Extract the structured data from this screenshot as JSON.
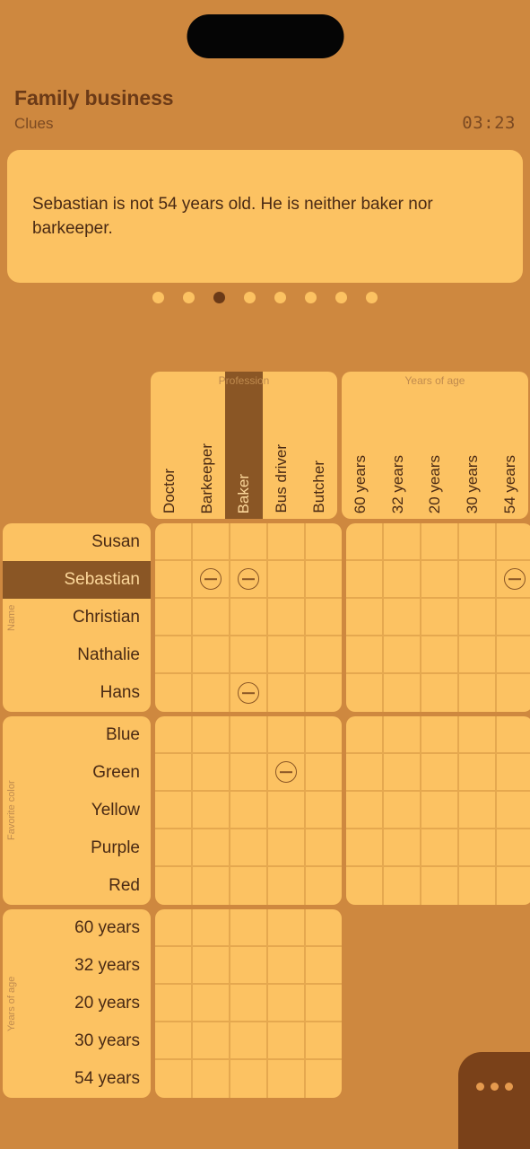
{
  "header": {
    "title": "Family business",
    "subtitle": "Clues",
    "timer": "03:23"
  },
  "clue": {
    "text": "Sebastian is not 54 years old. He is neither baker nor barkeeper."
  },
  "pager": {
    "total": 8,
    "active_index": 2
  },
  "colgroups": [
    {
      "title": "Profession",
      "columns": [
        "Doctor",
        "Barkeeper",
        "Baker",
        "Bus driver",
        "Butcher"
      ],
      "highlighted_column": 2
    },
    {
      "title": "Years of age",
      "columns": [
        "60 years",
        "32 years",
        "20 years",
        "30 years",
        "54 years"
      ],
      "highlighted_column": -1
    }
  ],
  "rowgroups": [
    {
      "title": "Name",
      "rows": [
        "Susan",
        "Sebastian",
        "Christian",
        "Nathalie",
        "Hans"
      ],
      "highlighted_row": 1,
      "blocks": [
        {
          "marks": [
            [
              "",
              "",
              "",
              "",
              ""
            ],
            [
              "",
              "minus",
              "minus",
              "",
              ""
            ],
            [
              "",
              "",
              "",
              "",
              ""
            ],
            [
              "",
              "",
              "",
              "",
              ""
            ],
            [
              "",
              "",
              "minus",
              "",
              ""
            ]
          ]
        },
        {
          "marks": [
            [
              "",
              "",
              "",
              "",
              ""
            ],
            [
              "",
              "",
              "",
              "",
              "minus"
            ],
            [
              "",
              "",
              "",
              "",
              ""
            ],
            [
              "",
              "",
              "",
              "",
              ""
            ],
            [
              "",
              "",
              "",
              "",
              ""
            ]
          ]
        }
      ]
    },
    {
      "title": "Favorite color",
      "rows": [
        "Blue",
        "Green",
        "Yellow",
        "Purple",
        "Red"
      ],
      "highlighted_row": -1,
      "blocks": [
        {
          "marks": [
            [
              "",
              "",
              "",
              "",
              ""
            ],
            [
              "",
              "",
              "",
              "minus",
              ""
            ],
            [
              "",
              "",
              "",
              "",
              ""
            ],
            [
              "",
              "",
              "",
              "",
              ""
            ],
            [
              "",
              "",
              "",
              "",
              ""
            ]
          ]
        },
        {
          "marks": [
            [
              "",
              "",
              "",
              "",
              ""
            ],
            [
              "",
              "",
              "",
              "",
              ""
            ],
            [
              "",
              "",
              "",
              "",
              ""
            ],
            [
              "",
              "",
              "",
              "",
              ""
            ],
            [
              "",
              "",
              "",
              "",
              ""
            ]
          ]
        }
      ]
    },
    {
      "title": "Years of age",
      "rows": [
        "60 years",
        "32 years",
        "20 years",
        "30 years",
        "54 years"
      ],
      "highlighted_row": -1,
      "blocks": [
        {
          "marks": [
            [
              "",
              "",
              "",
              "",
              ""
            ],
            [
              "",
              "",
              "",
              "",
              ""
            ],
            [
              "",
              "",
              "",
              "",
              ""
            ],
            [
              "",
              "",
              "",
              "",
              ""
            ],
            [
              "",
              "",
              "",
              "",
              ""
            ]
          ]
        }
      ]
    }
  ],
  "fab": {
    "icon": "more-horizontal-icon",
    "dots": 3
  },
  "colors": {
    "background": "#CE883F",
    "card": "#FCC262",
    "highlight": "#8A5625",
    "text_dark": "#4A2A14",
    "grid_line": "#E5A84F"
  }
}
